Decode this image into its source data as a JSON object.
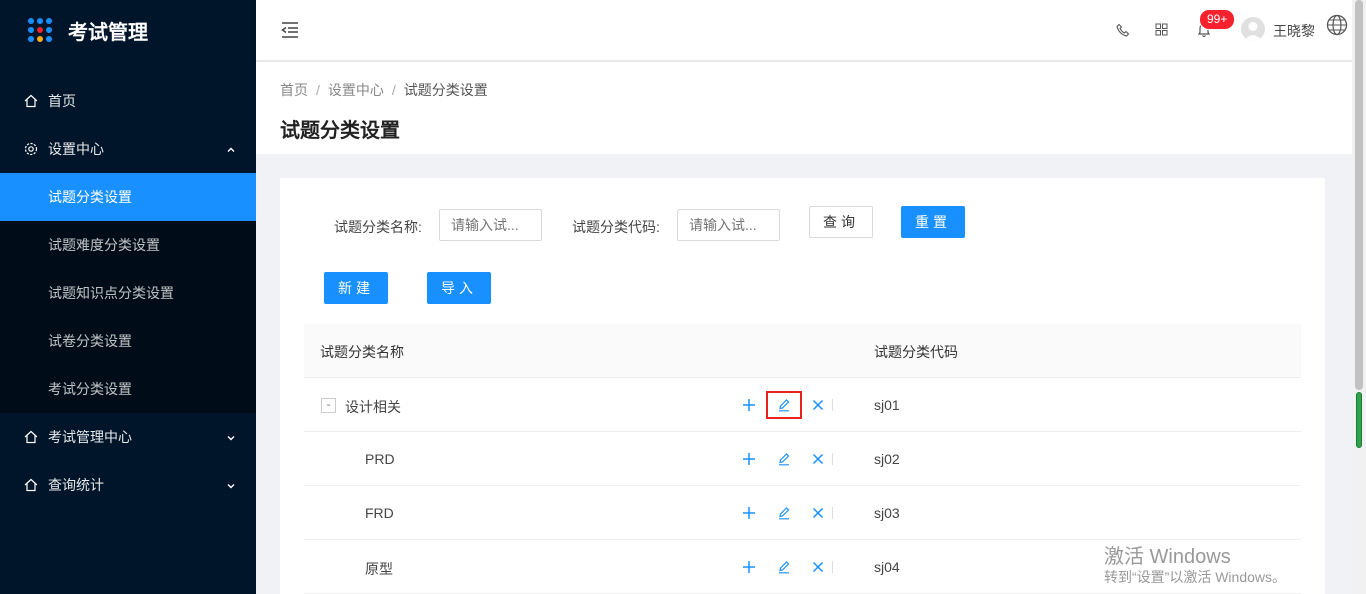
{
  "app": {
    "title": "考试管理"
  },
  "sidebar": {
    "items": [
      {
        "label": "首页"
      },
      {
        "label": "设置中心"
      },
      {
        "label": "考试管理中心"
      },
      {
        "label": "查询统计"
      }
    ],
    "sub_items": [
      {
        "label": "试题分类设置"
      },
      {
        "label": "试题难度分类设置"
      },
      {
        "label": "试题知识点分类设置"
      },
      {
        "label": "试卷分类设置"
      },
      {
        "label": "考试分类设置"
      }
    ]
  },
  "header": {
    "badge": "99+",
    "username": "王晓黎"
  },
  "breadcrumb": {
    "items": [
      "首页",
      "设置中心",
      "试题分类设置"
    ],
    "separator": "/"
  },
  "page": {
    "title": "试题分类设置"
  },
  "filters": {
    "name_label": "试题分类名称:",
    "name_placeholder": "请输入试...",
    "code_label": "试题分类代码:",
    "code_placeholder": "请输入试...",
    "query_label": "查询",
    "reset_label": "重置"
  },
  "actions": {
    "new_label": "新建",
    "import_label": "导入"
  },
  "table": {
    "columns": [
      "试题分类名称",
      "试题分类代码"
    ],
    "expander": "-",
    "rows": [
      {
        "name": "设计相关",
        "code": "sj01"
      },
      {
        "name": "PRD",
        "code": "sj02"
      },
      {
        "name": "FRD",
        "code": "sj03"
      },
      {
        "name": "原型",
        "code": "sj04"
      }
    ]
  },
  "watermark": {
    "line1": "激活 Windows",
    "line2": "转到“设置”以激活 Windows。"
  },
  "colors": {
    "sidebar": "#001529",
    "primary": "#1890ff",
    "highlight": "#e8231a",
    "badge": "#f5222d"
  }
}
